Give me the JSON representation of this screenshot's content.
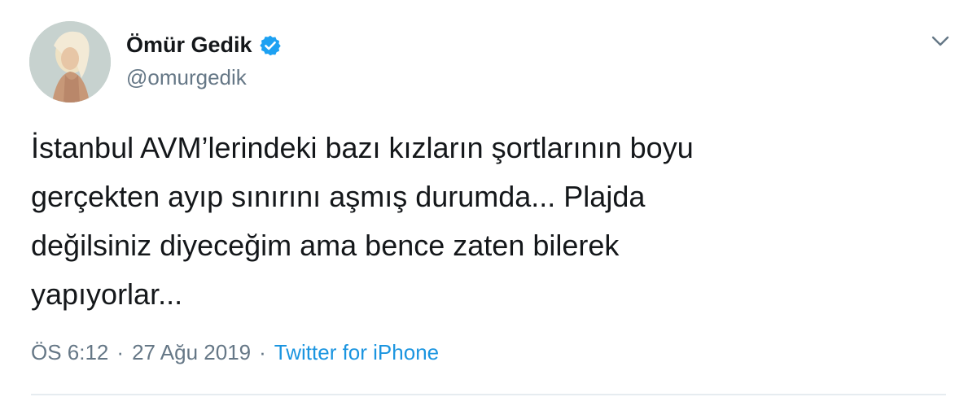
{
  "user": {
    "display_name": "Ömür Gedik",
    "handle": "@omurgedik",
    "verified": true
  },
  "tweet": {
    "text": "İstanbul AVM’lerindeki bazı kızların şortlarının boyu\ngerçekten ayıp sınırını aşmış durumda... Plajda\ndeğilsiniz diyeceğim ama bence zaten bilerek\nyapıyorlar...",
    "time": "ÖS 6:12",
    "separator": "·",
    "date": "27 Ağu 2019",
    "source": "Twitter for iPhone"
  },
  "icons": {
    "verified": "verified-badge-icon",
    "menu": "chevron-down-icon"
  },
  "colors": {
    "link": "#1b95e0",
    "secondary_text": "#657786",
    "verified_badge": "#1da1f2"
  }
}
